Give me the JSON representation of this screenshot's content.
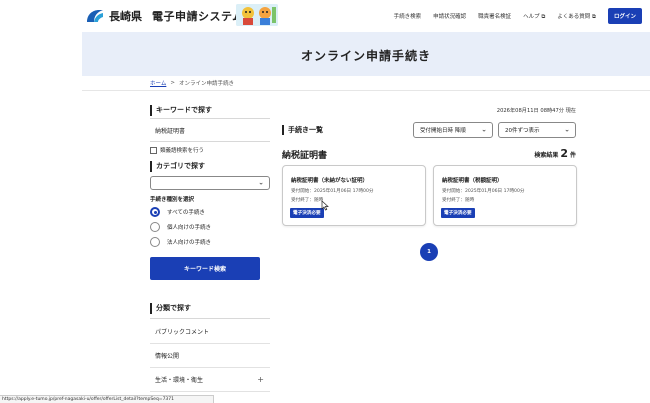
{
  "header": {
    "prefecture": "長崎県",
    "system_title": "電子申請システム",
    "nav": [
      "手続き検索",
      "申請状況確認",
      "職責署名検証",
      "ヘルプ ⧉",
      "よくある質問 ⧉"
    ],
    "login": "ログイン"
  },
  "banner": {
    "title": "オンライン申請手続き"
  },
  "breadcrumb": {
    "home": "ホーム",
    "sep": ">",
    "current": "オンライン申請手続き"
  },
  "sidebar": {
    "keyword_heading": "キーワードで探す",
    "keyword_value": "納税証明書",
    "synonym_label": "類義語検索を行う",
    "category_heading": "カテゴリで探す",
    "category_selected": "",
    "type_label": "手続き種別を選択",
    "types": [
      {
        "label": "すべての手続き",
        "selected": true
      },
      {
        "label": "個人向けの手続き",
        "selected": false
      },
      {
        "label": "法人向けの手続き",
        "selected": false
      }
    ],
    "search_button": "キーワード検索",
    "classification_heading": "分類で探す",
    "categories": [
      {
        "label": "パブリックコメント",
        "expandable": false
      },
      {
        "label": "情報公開",
        "expandable": false
      },
      {
        "label": "生活・環境・衛生",
        "expandable": true
      }
    ]
  },
  "main": {
    "timestamp": "2026年08月11日 08時47分 現在",
    "list_heading": "手続き一覧",
    "sort_selected": "受付開始日時 降順",
    "per_page_selected": "20件ずつ表示",
    "results_title": "納税証明書",
    "results_label": "検索結果",
    "results_count": "2",
    "results_unit": "件",
    "cards": [
      {
        "title": "納税証明書（未納がない証明）",
        "start": "受付開始：2025年01月06日 17時00分",
        "end": "受付終了：随時",
        "badge": "電子決済必要"
      },
      {
        "title": "納税証明書（税額証明）",
        "start": "受付開始：2025年01月06日 17時00分",
        "end": "受付終了：随時",
        "badge": "電子決済必要"
      }
    ],
    "page": "1"
  },
  "status_bar": {
    "url": "https://apply.e-tumo.jp/pref-nagasaki-u/offer/offerList_detail?tempSeq=7371"
  },
  "colors": {
    "accent": "#1a3fb5",
    "banner_bg": "#e8eef9"
  }
}
